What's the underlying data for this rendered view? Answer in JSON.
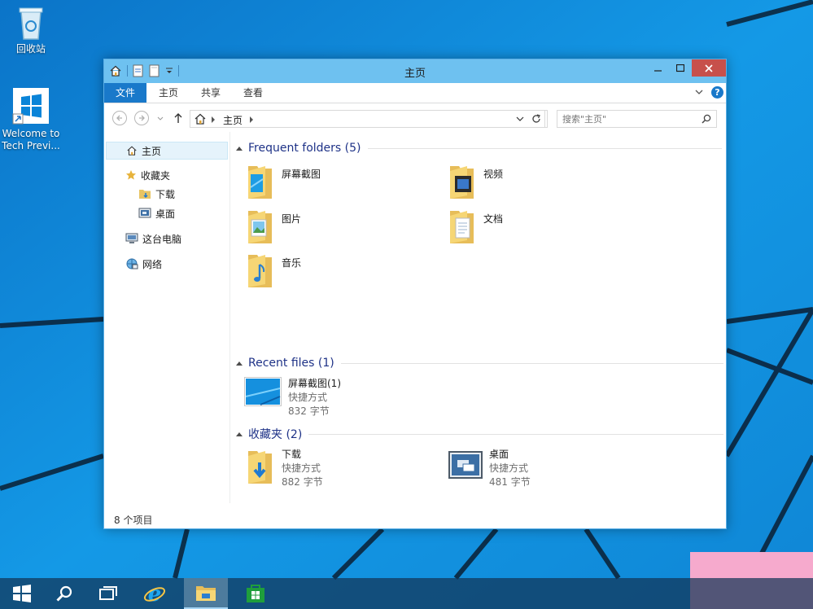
{
  "desktop": {
    "recycle_bin_label": "回收站",
    "welcome_label_line1": "Welcome to",
    "welcome_label_line2": "Tech Previ..."
  },
  "window": {
    "title": "主页",
    "ribbon": {
      "tabs": [
        "文件",
        "主页",
        "共享",
        "查看"
      ]
    },
    "address": {
      "crumb": "主页"
    },
    "search": {
      "placeholder": "搜索\"主页\""
    },
    "nav": {
      "home": "主页",
      "favorites": "收藏夹",
      "downloads": "下载",
      "desktop": "桌面",
      "this_pc": "这台电脑",
      "network": "网络"
    },
    "groups": {
      "frequent": {
        "title": "Frequent folders (5)",
        "items": [
          "屏幕截图",
          "视频",
          "图片",
          "文档",
          "音乐"
        ]
      },
      "recent": {
        "title": "Recent files (1)",
        "item": {
          "name": "屏幕截图(1)",
          "type": "快捷方式",
          "size": "832 字节"
        }
      },
      "favorites": {
        "title": "收藏夹 (2)",
        "items": [
          {
            "name": "下载",
            "type": "快捷方式",
            "size": "882 字节"
          },
          {
            "name": "桌面",
            "type": "快捷方式",
            "size": "481 字节"
          }
        ]
      }
    },
    "status": "8 个项目"
  },
  "colors": {
    "accent": "#1979ca",
    "titlebar": "#6ec1f0",
    "close": "#c7504b",
    "group_title": "#1e3287",
    "desktop_bg": "#0a8ad8"
  },
  "icons": [
    "recycle-bin-icon",
    "welcome-icon",
    "home-icon",
    "star-icon",
    "folder-icon",
    "computer-icon",
    "network-icon",
    "search-icon",
    "refresh-icon",
    "start-icon",
    "task-view-icon",
    "ie-icon",
    "explorer-icon",
    "store-icon"
  ]
}
